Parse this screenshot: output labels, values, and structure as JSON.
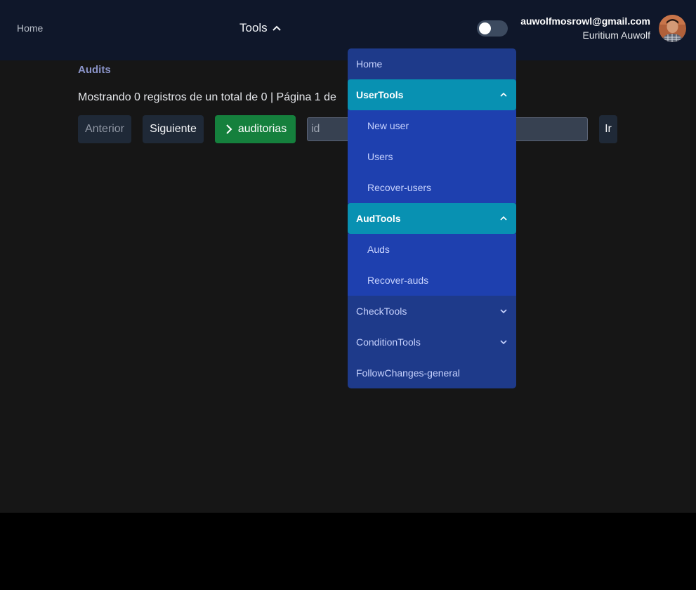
{
  "nav": {
    "home_label": "Home",
    "tools_label": "Tools"
  },
  "user": {
    "email": "auwolfmosrowl@gmail.com",
    "name": "Euritium Auwolf"
  },
  "page": {
    "title": "Audits",
    "pager_info": "Mostrando 0 registros de un total de 0 | Página 1 de"
  },
  "toolbar": {
    "prev_label": "Anterior",
    "next_label": "Siguiente",
    "audits_label": "auditorias",
    "id_placeholder": "id",
    "go_label": "Ir"
  },
  "menu": {
    "home": "Home",
    "user_tools": {
      "label": "UserTools",
      "items": [
        "New user",
        "Users",
        "Recover-users"
      ]
    },
    "aud_tools": {
      "label": "AudTools",
      "items": [
        "Auds",
        "Recover-auds"
      ]
    },
    "check_tools": "CheckTools",
    "condition_tools": "ConditionTools",
    "follow_changes": "FollowChanges-general"
  },
  "colors": {
    "navbar_bg": "#0f172a",
    "content_bg": "#161616",
    "menu_bg": "#1e3a8a",
    "submenu_bg": "#1e40af",
    "open_group_bg": "#0891b2",
    "audits_button_bg": "#15803d"
  },
  "icons": {
    "tools_caret": "chevron-up-icon",
    "audits_button": "chevron-right-icon",
    "open_group": "chevron-up-icon",
    "closed_group": "chevron-down-icon"
  }
}
